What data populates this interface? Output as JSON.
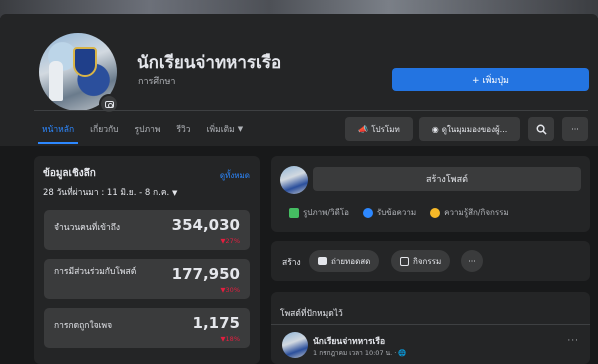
{
  "header": {
    "page_name": "นักเรียนจ่าทหารเรือ",
    "category": "การศึกษา",
    "add_button": "+ เพิ่มปุ่ม"
  },
  "tabs": [
    {
      "label": "หน้าหลัก"
    },
    {
      "label": "เกี่ยวกับ"
    },
    {
      "label": "รูปภาพ"
    },
    {
      "label": "รีวิว"
    },
    {
      "label": "เพิ่มเติม"
    }
  ],
  "header_actions": {
    "promote": "โปรโมท",
    "view_as": "ดูในมุมมองของผู้...",
    "search_icon": "search-icon",
    "more": "···"
  },
  "insights": {
    "title": "ข้อมูลเชิงลึก",
    "see_all": "ดูทั้งหมด",
    "range": "28 วันที่ผ่านมา : 11 มิ.ย. - 8 ก.ค.",
    "stats": [
      {
        "label": "จำนวนคนที่เข้าถึง",
        "value": "354,030",
        "change": "▼27%"
      },
      {
        "label": "การมีส่วนร่วมกับโพสต์",
        "value": "177,950",
        "change": "▼30%"
      },
      {
        "label": "การกดถูกใจเพจ",
        "value": "1,175",
        "change": "▼18%"
      }
    ]
  },
  "composer": {
    "create_post": "สร้างโพสต์",
    "photo_video": "รูปภาพ/วิดีโอ",
    "get_messages": "รับข้อความ",
    "feeling": "ความรู้สึก/กิจกรรม"
  },
  "create_row": {
    "label": "สร้าง",
    "live": "ถ่ายทอดสด",
    "event": "กิจกรรม",
    "more": "···"
  },
  "pinned": {
    "title": "โพสต์ที่ปักหมุดไว้",
    "author": "นักเรียนจ่าทหารเรือ",
    "meta": "1 กรกฎาคม เวลา 10:07 น. · 🌐",
    "more": "···"
  },
  "colors": {
    "accent": "#2374e1",
    "background": "#18191a",
    "card": "#242526",
    "negative": "#e41e3f"
  }
}
